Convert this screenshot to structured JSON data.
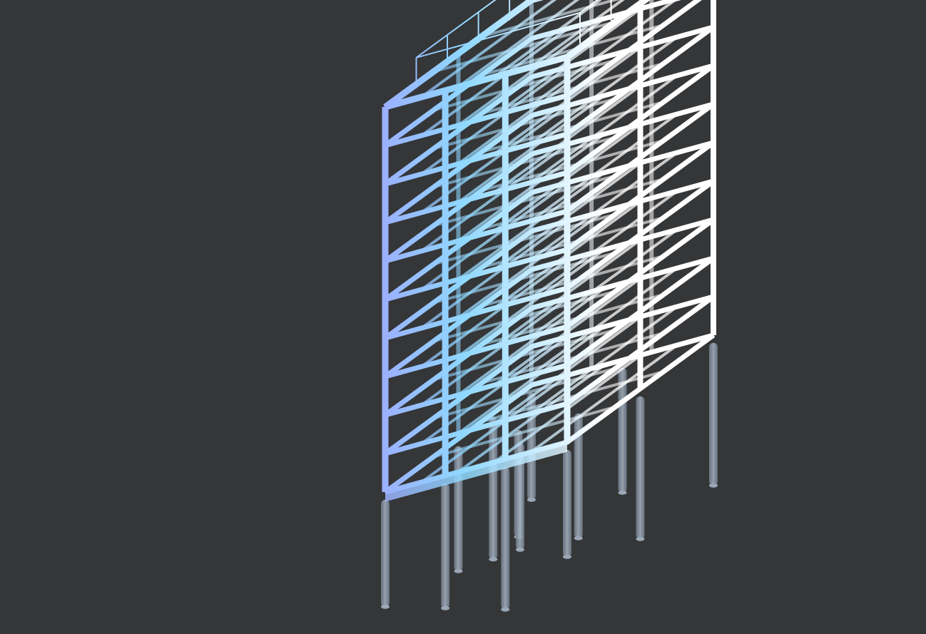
{
  "viewer": {
    "background_color": "#353638",
    "model": {
      "type": "structural-frame-3d",
      "floors": 10,
      "column_lines_depth": 4,
      "column_lines_width": 3,
      "piles_visible": true,
      "roof_railing_visible": true
    },
    "color_gradient": {
      "start": "#b45cff",
      "mid": "#8fd8ff",
      "end": "#ffffff"
    },
    "pile_color": "#8c9aab"
  }
}
